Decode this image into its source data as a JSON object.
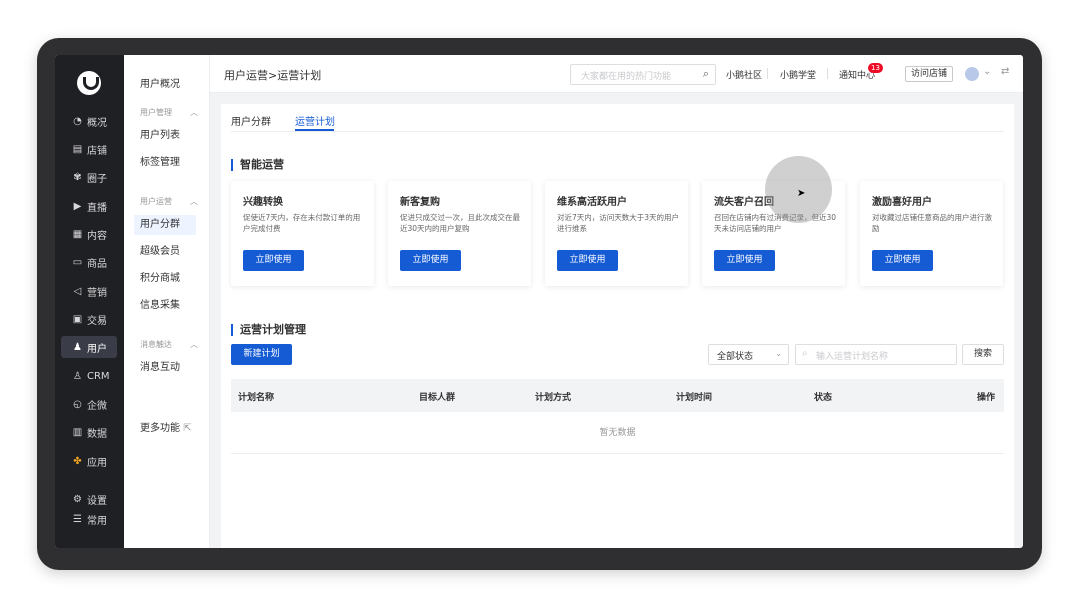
{
  "rail": {
    "items": [
      {
        "icon": "◔",
        "label": "概况"
      },
      {
        "icon": "▤",
        "label": "店铺"
      },
      {
        "icon": "✾",
        "label": "圈子"
      },
      {
        "icon": "▶",
        "label": "直播"
      },
      {
        "icon": "▦",
        "label": "内容"
      },
      {
        "icon": "▭",
        "label": "商品"
      },
      {
        "icon": "◁",
        "label": "营销"
      },
      {
        "icon": "▣",
        "label": "交易"
      },
      {
        "icon": "♟",
        "label": "用户"
      },
      {
        "icon": "♙",
        "label": "CRM"
      },
      {
        "icon": "◵",
        "label": "企微"
      },
      {
        "icon": "▥",
        "label": "数据"
      },
      {
        "icon": "✤",
        "label": "应用"
      },
      {
        "icon": "⚙",
        "label": "设置"
      },
      {
        "icon": "☰",
        "label": "常用"
      }
    ]
  },
  "subnav": {
    "overview": "用户概况",
    "group1": "用户管理",
    "list": "用户列表",
    "tags": "标签管理",
    "group2": "用户运营",
    "segment": "用户分群",
    "member": "超级会员",
    "points": "积分商城",
    "collect": "信息采集",
    "group3": "消息触达",
    "message": "消息互动",
    "more": "更多功能"
  },
  "header": {
    "breadcrumb": "用户运营>运营计划",
    "search_placeholder": "大家都在用的热门功能",
    "community": "小鹅社区",
    "school": "小鹅学堂",
    "notice": "通知中心",
    "notice_count": "13",
    "visit_store": "访问店铺"
  },
  "tabs": [
    "用户分群",
    "运营计划"
  ],
  "smart": {
    "title": "智能运营",
    "cards": [
      {
        "title": "兴趣转换",
        "desc": "促使近7天内，存在未付款订单的用户完成付费",
        "button": "立即使用"
      },
      {
        "title": "新客复购",
        "desc": "促进只成交过一次，且此次成交在最近30天内的用户复购",
        "button": "立即使用"
      },
      {
        "title": "维系高活跃用户",
        "desc": "对近7天内，访问天数大于3天的用户进行维系",
        "button": "立即使用"
      },
      {
        "title": "流失客户召回",
        "desc": "召回在店铺内有过消费记录，但近30天未访问店铺的用户",
        "button": "立即使用"
      },
      {
        "title": "激励喜好用户",
        "desc": "对收藏过店铺任意商品的用户进行激励",
        "button": "立即使用"
      }
    ]
  },
  "plans": {
    "title": "运营计划管理",
    "new_button": "新建计划",
    "status_select": "全部状态",
    "search_placeholder": "输入运营计划名称",
    "search_button": "搜索",
    "columns": [
      "计划名称",
      "目标人群",
      "计划方式",
      "计划时间",
      "状态",
      "操作"
    ],
    "empty_text": "暂无数据"
  }
}
